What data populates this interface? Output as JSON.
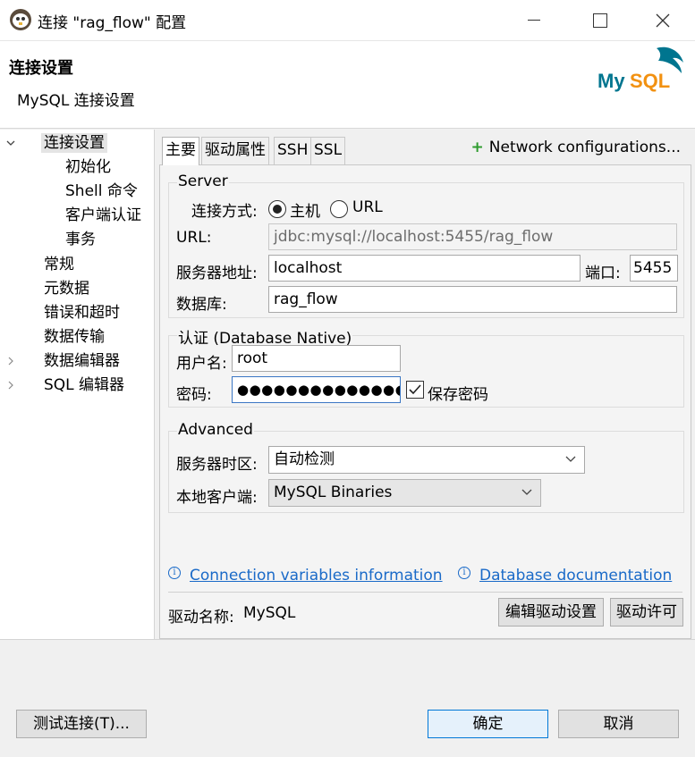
{
  "window": {
    "title": "连接 \"rag_flow\" 配置",
    "icon": "dbeaver-beaver-icon"
  },
  "header": {
    "title": "连接设置",
    "subtitle": "MySQL 连接设置",
    "logo_text": "MySQL"
  },
  "nav": {
    "items": [
      {
        "label": "连接设置",
        "expanded": true,
        "selected": true
      },
      {
        "label": "初始化"
      },
      {
        "label": "Shell 命令"
      },
      {
        "label": "客户端认证"
      },
      {
        "label": "事务"
      },
      {
        "label": "常规"
      },
      {
        "label": "元数据"
      },
      {
        "label": "错误和超时"
      },
      {
        "label": "数据传输"
      },
      {
        "label": "数据编辑器",
        "expandable": true
      },
      {
        "label": "SQL 编辑器",
        "expandable": true
      }
    ]
  },
  "tabs": [
    {
      "label": "主要",
      "active": true
    },
    {
      "label": "驱动属性"
    },
    {
      "label": "SSH"
    },
    {
      "label": "SSL"
    }
  ],
  "network_config": "Network configurations...",
  "server": {
    "title": "Server",
    "connect_by_label": "连接方式:",
    "option_host": "主机",
    "option_url": "URL",
    "selected": "主机",
    "url_label": "URL:",
    "url_value": "jdbc:mysql://localhost:5455/rag_flow",
    "host_label": "服务器地址:",
    "host_value": "localhost",
    "port_label": "端口:",
    "port_value": "5455",
    "database_label": "数据库:",
    "database_value": "rag_flow"
  },
  "auth": {
    "title": "认证 (Database Native)",
    "username_label": "用户名:",
    "username_value": "root",
    "password_label": "密码:",
    "password_value": "●●●●●●●●●●●●●●●",
    "save_password_label": "保存密码",
    "save_password_checked": true
  },
  "advanced": {
    "title": "Advanced",
    "timezone_label": "服务器时区:",
    "timezone_value": "自动检测",
    "local_client_label": "本地客户端:",
    "local_client_value": "MySQL Binaries"
  },
  "links": {
    "conn_vars": "Connection variables information",
    "db_docs": "Database documentation"
  },
  "driver": {
    "name_label": "驱动名称:",
    "name_value": "MySQL",
    "edit_button": "编辑驱动设置",
    "license_button": "驱动许可"
  },
  "footer": {
    "test_button": "测试连接(T)...",
    "ok_button": "确定",
    "cancel_button": "取消"
  },
  "colors": {
    "link": "#1a6ac8",
    "default_button_border": "#0078d7",
    "plus": "#2e9b2e",
    "mysql_blue": "#00758f",
    "mysql_orange": "#f29111"
  }
}
